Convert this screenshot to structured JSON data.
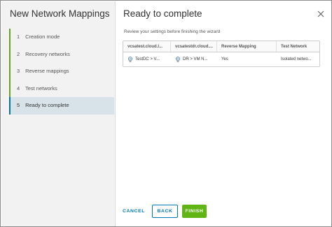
{
  "wizard": {
    "title": "New Network Mappings",
    "steps": [
      {
        "num": "1",
        "label": "Creation mode",
        "state": "done"
      },
      {
        "num": "2",
        "label": "Recovery networks",
        "state": "done"
      },
      {
        "num": "3",
        "label": "Reverse mappings",
        "state": "done"
      },
      {
        "num": "4",
        "label": "Test networks",
        "state": "done"
      },
      {
        "num": "5",
        "label": "Ready to complete",
        "state": "active"
      }
    ]
  },
  "page": {
    "title": "Ready to complete",
    "subtitle": "Review your settings before finishing the wizard"
  },
  "grid": {
    "columns": [
      "vcsatest.cloud.l...",
      "vcsatestdr.cloud....",
      "Reverse Mapping",
      "Test Network"
    ],
    "rows": [
      {
        "protected": "TestDC > V...",
        "recovery": "DR > VM N...",
        "reverse": "Yes",
        "test": "Isolated netwo..."
      }
    ]
  },
  "buttons": {
    "cancel": "CANCEL",
    "back": "BACK",
    "finish": "FINISH"
  },
  "colors": {
    "done_step_accent": "#62a420",
    "active_step_bg": "#d8e3e9",
    "link_blue": "#0079b8",
    "finish_green": "#60b515"
  },
  "icons": {
    "close": "close-icon",
    "network": "network-icon"
  }
}
